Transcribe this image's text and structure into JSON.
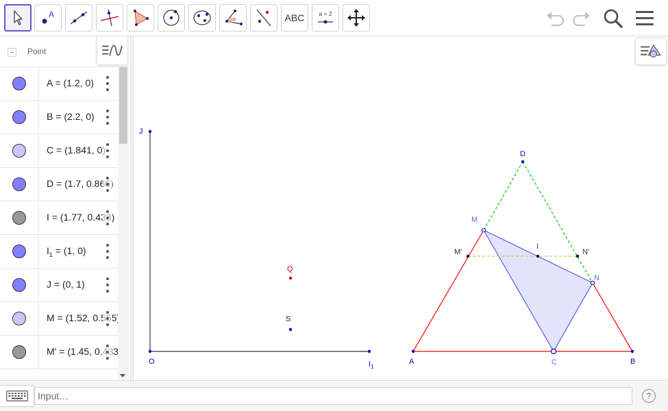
{
  "toolbar": {
    "tools": [
      {
        "id": "move",
        "icon": "arrow-pointer-icon",
        "active": true
      },
      {
        "id": "point",
        "icon": "point-icon",
        "label": "A"
      },
      {
        "id": "line",
        "icon": "line-icon"
      },
      {
        "id": "perpendicular",
        "icon": "perpendicular-line-icon"
      },
      {
        "id": "polygon",
        "icon": "polygon-icon"
      },
      {
        "id": "circle-center-point",
        "icon": "circle-icon"
      },
      {
        "id": "ellipse",
        "icon": "ellipse-icon"
      },
      {
        "id": "angle",
        "icon": "angle-icon",
        "label": "α"
      },
      {
        "id": "reflect",
        "icon": "reflect-icon"
      },
      {
        "id": "text",
        "icon": "text-icon",
        "label": "ABC"
      },
      {
        "id": "slider",
        "icon": "slider-icon",
        "label": "a = 2"
      },
      {
        "id": "move-graphics",
        "icon": "move-graphics-icon"
      }
    ],
    "undo_icon": "undo-icon",
    "redo_icon": "redo-icon",
    "search_icon": "search-icon",
    "menu_icon": "menu-icon"
  },
  "algebra": {
    "group_label": "Point",
    "rows": [
      {
        "name": "A",
        "value": "(1.2, 0)",
        "color": "#8080ff"
      },
      {
        "name": "B",
        "value": "(2.2, 0)",
        "color": "#8080ff"
      },
      {
        "name": "C",
        "value": "(1.841, 0)",
        "color": "#c8c8ff"
      },
      {
        "name": "D",
        "value": "(1.7, 0.866)",
        "color": "#8080ff"
      },
      {
        "name": "I",
        "value": "(1.77, 0.433)",
        "color": "#999999"
      },
      {
        "name": "I",
        "sub": "1",
        "value": "(1, 0)",
        "color": "#8080ff"
      },
      {
        "name": "J",
        "value": "(0, 1)",
        "color": "#8080ff"
      },
      {
        "name": "M",
        "value": "(1.52, 0.555)",
        "color": "#c8c8ff"
      },
      {
        "name": "M'",
        "value": "(1.45, 0.433)",
        "color": "#999999"
      }
    ]
  },
  "graphics": {
    "labels": {
      "J": "J",
      "O": "O",
      "I1": "I",
      "I1_sub": "1",
      "Q": "Q",
      "S": "S",
      "D": "D",
      "M": "M",
      "I": "I",
      "Mp": "M'",
      "Np": "N'",
      "N": "N",
      "A": "A",
      "C": "C",
      "B": "B"
    },
    "colors": {
      "axis": "#333333",
      "point_blue": "#0000cc",
      "point_red": "#cc0000",
      "triangle_red": "#ff0000",
      "dash_green": "#00cc00",
      "dash_lime": "#aadd44",
      "polygon_fill": "#e2e4fb",
      "polygon_stroke": "#5a5ae6"
    }
  },
  "input": {
    "placeholder": "Input…",
    "help": "?"
  }
}
